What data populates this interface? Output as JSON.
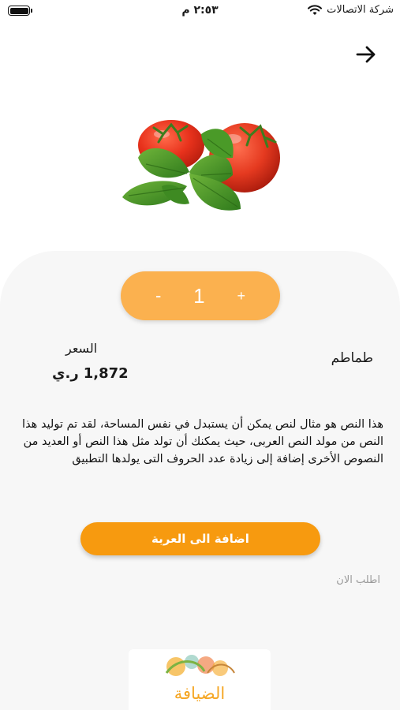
{
  "status_bar": {
    "time": "٢:٥٣ م",
    "carrier": "شركة الاتصالات"
  },
  "product": {
    "name": "طماطم",
    "price_label": "السعر",
    "price_value": "1,872",
    "currency": "ر.ي",
    "quantity": "1",
    "minus_label": "-",
    "plus_label": "+",
    "description": "هذا النص هو مثال لنص يمكن أن يستبدل في نفس المساحة، لقد تم توليد هذا النص من مولد النص العربى، حيث يمكنك أن تولد مثل هذا النص أو العديد من النصوص الأخرى إضافة إلى زيادة عدد الحروف التى يولدها التطبيق"
  },
  "actions": {
    "add_to_cart": "اضافة الى العربة",
    "order_now": "اطلب الان"
  },
  "logo": {
    "text": "الضيافة"
  },
  "colors": {
    "stepper": "#fbb14f",
    "button": "#f79a0f",
    "panel": "#f7f7f7"
  },
  "icons": {
    "back": "arrow-right-icon",
    "wifi": "wifi-icon",
    "battery": "battery-icon"
  }
}
